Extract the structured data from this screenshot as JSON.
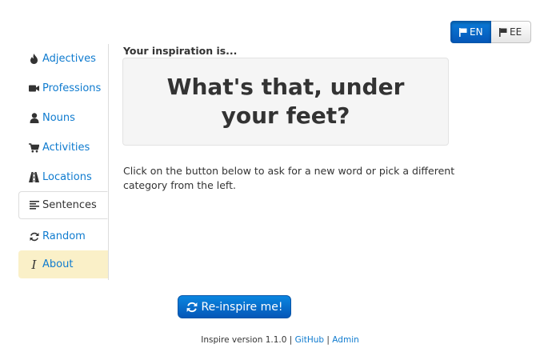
{
  "language": {
    "en_label": "EN",
    "ee_label": "EE",
    "selected": "EN"
  },
  "sidebar": {
    "items": [
      {
        "label": "Adjectives",
        "icon": "fire-icon"
      },
      {
        "label": "Professions",
        "icon": "video-camera-icon"
      },
      {
        "label": "Nouns",
        "icon": "user-icon"
      },
      {
        "label": "Activities",
        "icon": "shopping-cart-icon"
      },
      {
        "label": "Locations",
        "icon": "road-icon"
      },
      {
        "label": "Sentences",
        "icon": "align-left-icon"
      },
      {
        "label": "Random",
        "icon": "refresh-icon"
      },
      {
        "label": "About",
        "icon": "italic-icon"
      }
    ],
    "active": "Sentences"
  },
  "main": {
    "lead": "Your inspiration is...",
    "inspiration": "What's that, under your feet?",
    "hint": "Click on the button below to ask for a new word or pick a different category from the left.",
    "button_label": "Re-inspire me!"
  },
  "footer": {
    "version_text": "Inspire version 1.1.0",
    "separator": "|",
    "github_label": "GitHub",
    "admin_label": "Admin"
  },
  "colors": {
    "link": "#0f7bcf",
    "primary": "#0557b8",
    "about_highlight": "#faf0c8"
  }
}
